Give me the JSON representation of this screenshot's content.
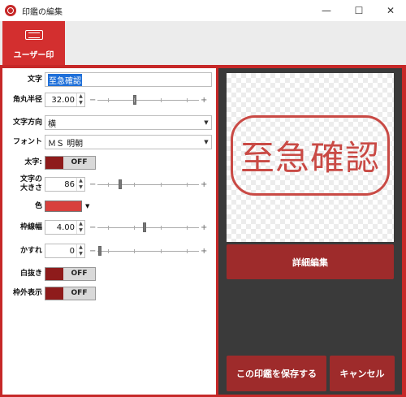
{
  "window": {
    "title": "印鑑の編集",
    "minimize": "—",
    "maximize": "☐",
    "close": "✕"
  },
  "tab": {
    "label": "ユーザー印",
    "icon": "stamp-card-icon"
  },
  "form": {
    "text": {
      "label": "文字",
      "value": "至急確認"
    },
    "corner_radius": {
      "label": "角丸半径",
      "value": "32.00",
      "level": 0.37
    },
    "direction": {
      "label": "文字方向",
      "value": "横"
    },
    "font": {
      "label": "フォント",
      "value": "ＭＳ 明朝"
    },
    "bold": {
      "label": "太字:",
      "state": "OFF"
    },
    "text_size": {
      "label1": "文字の",
      "label2": "大きさ",
      "value": "86",
      "level": 0.22
    },
    "color": {
      "label": "色",
      "value": "#d8403d"
    },
    "border_width": {
      "label": "枠線幅",
      "value": "4.00",
      "level": 0.46
    },
    "blur": {
      "label": "かすれ",
      "value": "0",
      "level": 0.02
    },
    "invert": {
      "label": "白抜き",
      "state": "OFF"
    },
    "outside": {
      "label": "枠外表示",
      "state": "OFF"
    }
  },
  "preview": {
    "stamp_text": "至急確認",
    "stamp_color": "#c94a45"
  },
  "buttons": {
    "detail_edit": "詳細編集",
    "save": "この印鑑を保存する",
    "cancel": "キャンセル"
  },
  "colors": {
    "accent": "#d32f2f",
    "button": "#9e2b2b",
    "panel": "#3a3a3a"
  }
}
